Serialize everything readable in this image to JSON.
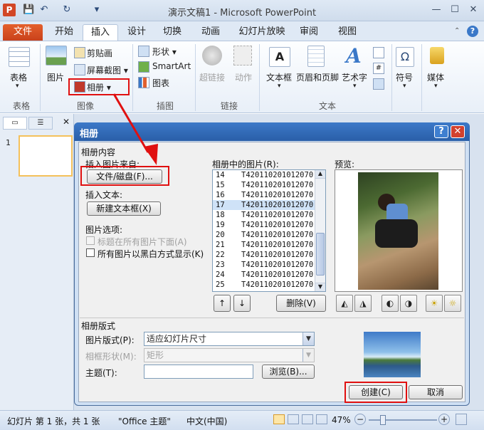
{
  "window": {
    "title": "演示文稿1 - Microsoft PowerPoint",
    "app_icon": "P",
    "qa_save": "💾",
    "qa_undo": "↶",
    "qa_redo": "↻",
    "qa_more": "▾",
    "min": "—",
    "max": "☐",
    "close": "✕"
  },
  "tabs": {
    "file": "文件",
    "home": "开始",
    "insert": "插入",
    "design": "设计",
    "transitions": "切换",
    "animations": "动画",
    "slideshow": "幻灯片放映",
    "review": "审阅",
    "view": "视图"
  },
  "ribbon": {
    "table": "表格",
    "picture": "图片",
    "clipart": "剪贴画",
    "screenshot": "屏幕截图 ▾",
    "album": "相册 ▾",
    "shapes": "形状 ▾",
    "smartart": "SmartArt",
    "chart": "图表",
    "hyperlink": "超链接",
    "action": "动作",
    "textbox": "文本框",
    "headerfooter": "页眉和页脚",
    "wordart": "艺术字",
    "symbol": "符号",
    "media": "媒体",
    "groups": {
      "table": "表格",
      "image": "图像",
      "illustrations": "插图",
      "links": "链接",
      "text": "文本"
    }
  },
  "dialog": {
    "title": "相册",
    "help": "?",
    "close": "✕",
    "section_content": "相册内容",
    "insert_from": "插入图片来自:",
    "file_disk": "文件/磁盘(F)...",
    "insert_text": "插入文本:",
    "new_textbox": "新建文本框(X)",
    "pic_options": "图片选项:",
    "captions": "标题在所有图片下面(A)",
    "blackwhite": "所有图片以黑白方式显示(K)",
    "pics_in_album": "相册中的图片(R):",
    "preview": "预览:",
    "up": "↑",
    "down": "↓",
    "delete": "删除(V)",
    "rows": [
      {
        "n": "14",
        "name": "T420110201012070"
      },
      {
        "n": "15",
        "name": "T420110201012070"
      },
      {
        "n": "16",
        "name": "T420110201012070"
      },
      {
        "n": "17",
        "name": "T420110201012070"
      },
      {
        "n": "18",
        "name": "T420110201012070"
      },
      {
        "n": "19",
        "name": "T420110201012070"
      },
      {
        "n": "20",
        "name": "T420110201012070"
      },
      {
        "n": "21",
        "name": "T420110201012070"
      },
      {
        "n": "22",
        "name": "T420110201012070"
      },
      {
        "n": "23",
        "name": "T420110201012070"
      },
      {
        "n": "24",
        "name": "T420110201012070"
      },
      {
        "n": "25",
        "name": "T420110201012070"
      }
    ],
    "selected_row": "17",
    "rot_left": "◭",
    "rot_right": "◮",
    "contrast_up": "◐",
    "contrast_down": "◑",
    "bright_up": "☀",
    "bright_down": "☼",
    "section_layout": "相册版式",
    "pic_layout_label": "图片版式(P):",
    "pic_layout_value": "适应幻灯片尺寸",
    "frame_label": "相框形状(M):",
    "frame_value": "矩形",
    "theme_label": "主题(T):",
    "theme_value": "",
    "browse": "浏览(B)...",
    "create": "创建(C)",
    "cancel": "取消"
  },
  "statusbar": {
    "slide": "幻灯片 第 1 张，共 1 张",
    "theme": "\"Office 主题\"",
    "lang": "中文(中国)",
    "zoom": "47%"
  },
  "colors": {
    "accent": "#2a5fa8",
    "file_tab": "#d24726",
    "highlight": "#e01010"
  }
}
